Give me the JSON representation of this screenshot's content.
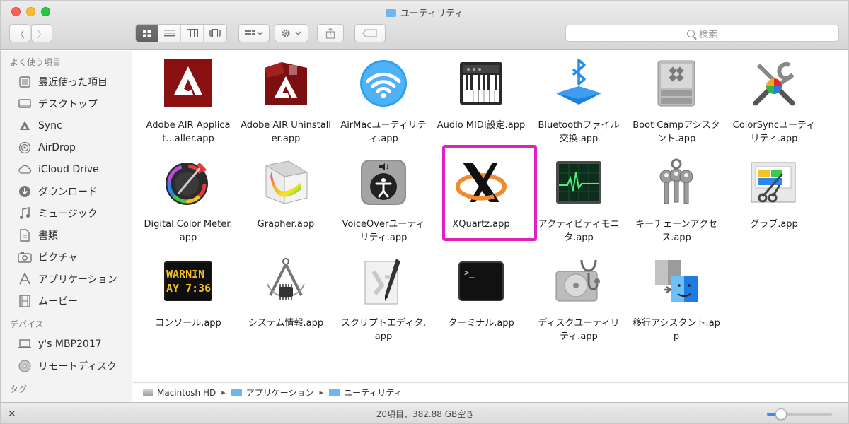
{
  "window": {
    "title": "ユーティリティ"
  },
  "toolbar": {
    "back": "〈",
    "forward": "〉",
    "search_placeholder": "検索",
    "view_modes": [
      "icon-view",
      "list-view",
      "column-view",
      "coverflow-view"
    ],
    "active_view_index": 0
  },
  "sidebar": {
    "favorites_header": "よく使う項目",
    "favorites": [
      {
        "label": "最近使った項目",
        "icon": "recents-icon"
      },
      {
        "label": "デスクトップ",
        "icon": "desktop-icon"
      },
      {
        "label": "Sync",
        "icon": "sync-icon"
      },
      {
        "label": "AirDrop",
        "icon": "airdrop-icon"
      },
      {
        "label": "iCloud Drive",
        "icon": "icloud-icon"
      },
      {
        "label": "ダウンロード",
        "icon": "downloads-icon"
      },
      {
        "label": "ミュージック",
        "icon": "music-icon"
      },
      {
        "label": "書類",
        "icon": "documents-icon"
      },
      {
        "label": "ピクチャ",
        "icon": "pictures-icon"
      },
      {
        "label": "アプリケーション",
        "icon": "applications-icon"
      },
      {
        "label": "ムービー",
        "icon": "movies-icon"
      }
    ],
    "devices_header": "デバイス",
    "devices": [
      {
        "label": "y's MBP2017",
        "icon": "laptop-icon"
      },
      {
        "label": "リモートディスク",
        "icon": "disc-icon"
      }
    ],
    "tags_header": "タグ"
  },
  "files": [
    {
      "label": "Adobe AIR Applicat...aller.app",
      "icon": "adobe-air-installer-icon"
    },
    {
      "label": "Adobe AIR Uninstaller.app",
      "icon": "adobe-air-uninstaller-icon"
    },
    {
      "label": "AirMacユーティリティ.app",
      "icon": "airmac-utility-icon"
    },
    {
      "label": "Audio MIDI設定.app",
      "icon": "audio-midi-icon"
    },
    {
      "label": "Bluetoothファイル交換.app",
      "icon": "bluetooth-exchange-icon"
    },
    {
      "label": "Boot Campアシスタント.app",
      "icon": "bootcamp-icon"
    },
    {
      "label": "ColorSyncユーティリティ.app",
      "icon": "colorsync-icon"
    },
    {
      "label": "Digital Color Meter.app",
      "icon": "digital-color-meter-icon"
    },
    {
      "label": "Grapher.app",
      "icon": "grapher-icon"
    },
    {
      "label": "VoiceOverユーティリティ.app",
      "icon": "voiceover-icon"
    },
    {
      "label": "XQuartz.app",
      "icon": "xquartz-icon",
      "highlighted": true
    },
    {
      "label": "アクティビティモニタ.app",
      "icon": "activity-monitor-icon"
    },
    {
      "label": "キーチェーンアクセス.app",
      "icon": "keychain-icon"
    },
    {
      "label": "グラブ.app",
      "icon": "grab-icon"
    },
    {
      "label": "コンソール.app",
      "icon": "console-icon"
    },
    {
      "label": "システム情報.app",
      "icon": "system-info-icon"
    },
    {
      "label": "スクリプトエディタ.app",
      "icon": "script-editor-icon"
    },
    {
      "label": "ターミナル.app",
      "icon": "terminal-icon"
    },
    {
      "label": "ディスクユーティリティ.app",
      "icon": "disk-utility-icon"
    },
    {
      "label": "移行アシスタント.app",
      "icon": "migration-assistant-icon"
    }
  ],
  "console_text": {
    "line1": "WARNIN",
    "line2": "AY 7:36"
  },
  "highlight_color": "#e021bf",
  "pathbar": [
    "Macintosh HD",
    "アプリケーション",
    "ユーティリティ"
  ],
  "status": {
    "text": "20項目、382.88 GB空き",
    "zoom_fraction": 0.22
  }
}
